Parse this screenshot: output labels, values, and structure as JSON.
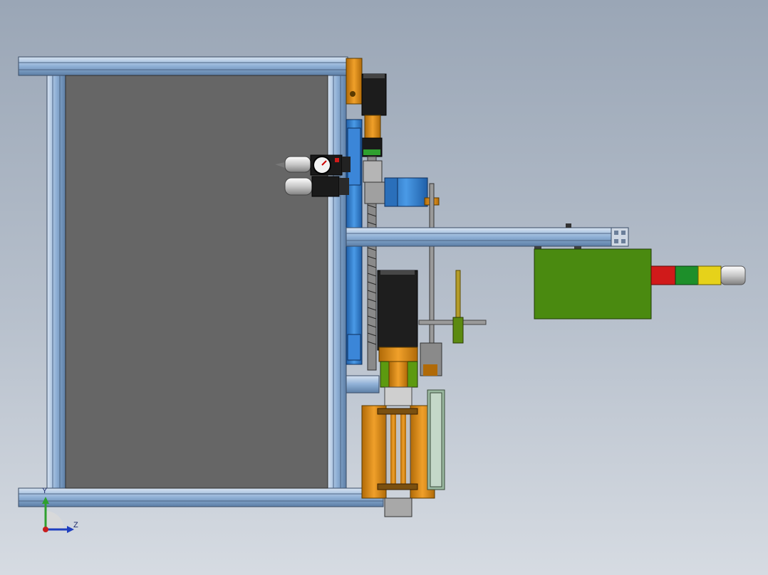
{
  "view": {
    "background_top": "#9aa6b6",
    "background_bottom": "#d6dbe2"
  },
  "triad": {
    "y_label": "Y",
    "z_label": "Z",
    "y_color": "#2fa02f",
    "z_color": "#1f3fbf",
    "x_color": "#c81e1e"
  },
  "colors": {
    "aluminum": "#8fb0d6",
    "panel": "#666666",
    "orange": "#e08a12",
    "blue": "#2f7fd0",
    "green_box": "#4a8a10",
    "motor_black": "#222222",
    "light_red": "#d01a1a",
    "light_green": "#1d8f2a",
    "light_yellow": "#e6d21a",
    "light_white": "#e8e8e8"
  },
  "parts": {
    "frame": "aluminum-frame",
    "panel": "gray-panel",
    "stepper_top": "stepper-motor-top",
    "filter_regulator": "air-filter-regulator",
    "gearbox": "blue-gearbox",
    "arm": "horizontal-arm",
    "control_box": "green-control-box",
    "tower_light": "signal-tower-light",
    "servo_motor": "servo-motor",
    "leadscrew": "lead-screw",
    "cylinder_assembly": "cylinder-assembly"
  }
}
